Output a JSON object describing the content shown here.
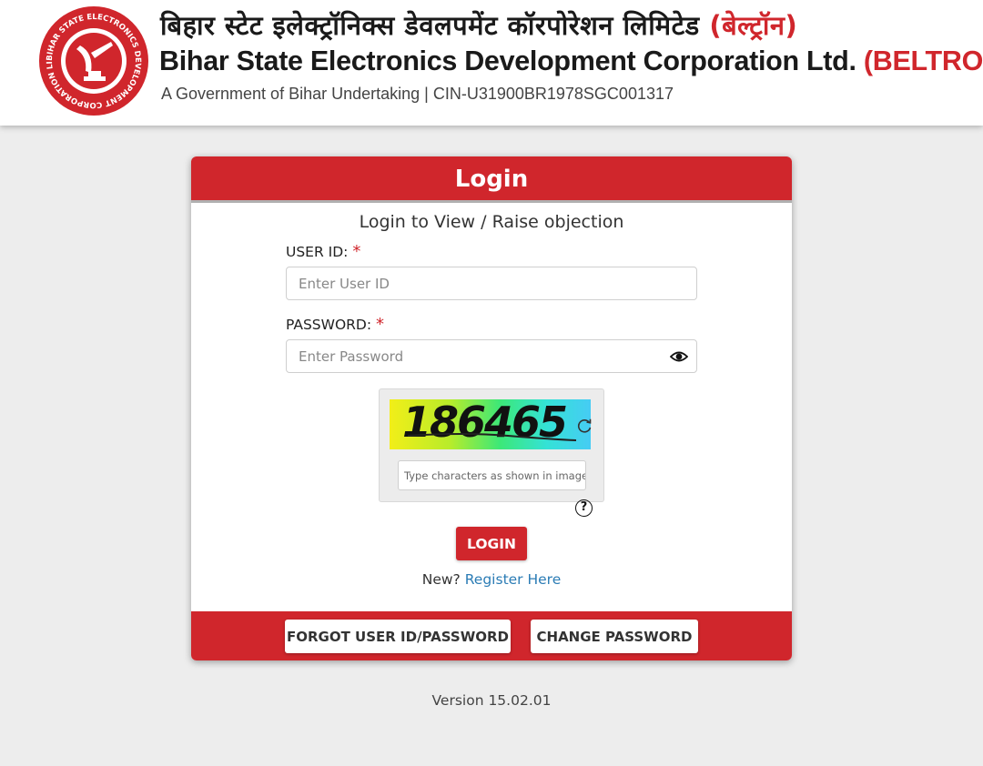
{
  "header": {
    "hindi_title": "बिहार स्टेट इलेक्ट्रॉनिक्स डेवलपमेंट कॉरपोरेशन लिमिटेड",
    "hindi_abbr": "(बेल्ट्रॉन)",
    "english_title": "Bihar State Electronics Development Corporation Ltd.",
    "english_abbr": "(BELTRON)",
    "subtitle": "A Government of Bihar Undertaking  |  CIN-U31900BR1978SGC001317",
    "logo_text": "BIHAR STATE ELECTRONICS DEVELOPMENT CORPORATION LIMITED"
  },
  "login": {
    "title": "Login",
    "subtitle": "Login to View / Raise objection",
    "user_id_label": "USER ID:",
    "user_id_placeholder": "Enter User ID",
    "password_label": "PASSWORD:",
    "password_placeholder": "Enter Password",
    "required_mark": "*",
    "captcha_value": "186465",
    "captcha_placeholder": "Type characters as shown in image",
    "help_symbol": "?",
    "login_button": "LOGIN",
    "new_text": "New?",
    "register_link": "Register Here"
  },
  "footer_buttons": {
    "forgot": "FORGOT USER ID/PASSWORD",
    "change": "CHANGE PASSWORD"
  },
  "version": "Version 15.02.01",
  "colors": {
    "brand_red": "#d0262c",
    "link_blue": "#2b7cb5",
    "background": "#ededed"
  },
  "icons": {
    "logo": "beltron-emblem-icon",
    "password_toggle": "eye-icon",
    "captcha_refresh": "refresh-icon",
    "captcha_help": "help-icon"
  }
}
